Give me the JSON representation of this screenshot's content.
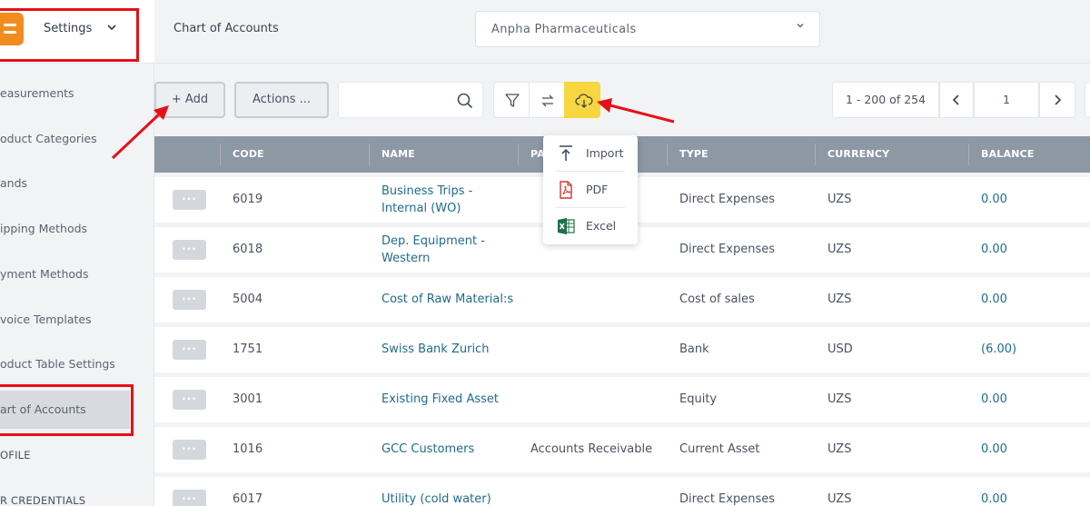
{
  "sidebar": {
    "settings_label": "Settings",
    "items": [
      {
        "label": "easurements"
      },
      {
        "label": "oduct Categories"
      },
      {
        "label": "ands"
      },
      {
        "label": "ipping Methods"
      },
      {
        "label": "yment Methods"
      },
      {
        "label": "voice Templates"
      },
      {
        "label": "oduct Table Settings"
      },
      {
        "label": "art of Accounts"
      },
      {
        "label": "OFILE"
      },
      {
        "label": "R CREDENTIALS"
      }
    ]
  },
  "header": {
    "page_title": "Chart of Accounts",
    "company": "Anpha Pharmaceuticals"
  },
  "toolbar": {
    "add_label": "+ Add",
    "actions_label": "Actions ...",
    "search_placeholder": "",
    "pagination": {
      "range": "1 - 200 of 254",
      "prev": "‹",
      "page": "1",
      "next": "›"
    }
  },
  "export_menu": {
    "import_label": "Import",
    "pdf_label": "PDF",
    "excel_label": "Excel"
  },
  "table": {
    "columns": {
      "code": "CODE",
      "name": "NAME",
      "parent": "PA",
      "type": "TYPE",
      "currency": "CURRENCY",
      "balance": "BALANCE"
    },
    "rows": [
      {
        "code": "6019",
        "name1": "Business Trips -",
        "name2": "Internal (WO)",
        "parent": "",
        "type": "Direct Expenses",
        "currency": "UZS",
        "balance": "0.00"
      },
      {
        "code": "6018",
        "name1": "Dep. Equipment -",
        "name2": "Western",
        "parent": "",
        "type": "Direct Expenses",
        "currency": "UZS",
        "balance": "0.00"
      },
      {
        "code": "5004",
        "name1": "Cost of Raw Material:s",
        "name2": "",
        "parent": "",
        "type": "Cost of sales",
        "currency": "UZS",
        "balance": "0.00"
      },
      {
        "code": "1751",
        "name1": "Swiss Bank Zurich",
        "name2": "",
        "parent": "",
        "type": "Bank",
        "currency": "USD",
        "balance": "(6.00)"
      },
      {
        "code": "3001",
        "name1": "Existing Fixed Asset",
        "name2": "",
        "parent": "",
        "type": "Equity",
        "currency": "UZS",
        "balance": "0.00"
      },
      {
        "code": "1016",
        "name1": "GCC Customers",
        "name2": "",
        "parent": "Accounts Receivable",
        "type": "Current Asset",
        "currency": "UZS",
        "balance": "0.00"
      },
      {
        "code": "6017",
        "name1": "Utility (cold water)",
        "name2": "",
        "parent": "",
        "type": "Direct Expenses",
        "currency": "UZS",
        "balance": "0.00"
      }
    ],
    "row_menu_label": "···"
  },
  "colors": {
    "accent_yellow": "#f7d63f",
    "highlight_red": "#e3101a",
    "link_blue": "#1f6c8c",
    "header_gray": "#8d98a5",
    "logo_orange": "#f28c1e"
  }
}
